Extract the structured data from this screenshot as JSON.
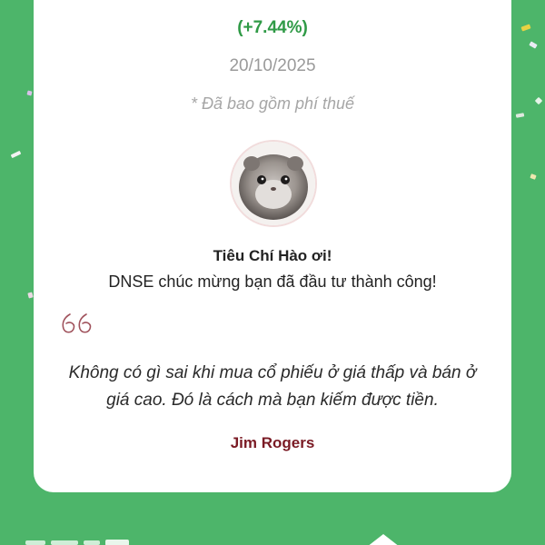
{
  "card": {
    "change_percent": "(+7.44%)",
    "date": "20/10/2025",
    "fee_note": "* Đã bao gồm phí thuế",
    "avatar_icon": "hamster-avatar-icon",
    "greeting": "Tiêu Chí Hào ơi!",
    "congrats": "DNSE chúc mừng bạn đã đầu tư thành công!",
    "quote_icon": "quote-icon",
    "quote": "Không có gì sai khi mua cổ phiếu ở giá thấp và bán ở giá cao. Đó là cách mà bạn kiếm được tiền.",
    "author": "Jim Rogers"
  },
  "colors": {
    "background": "#4db56a",
    "positive": "#2f9a46",
    "author": "#7a1a24",
    "quote_mark": "#a0525c"
  }
}
